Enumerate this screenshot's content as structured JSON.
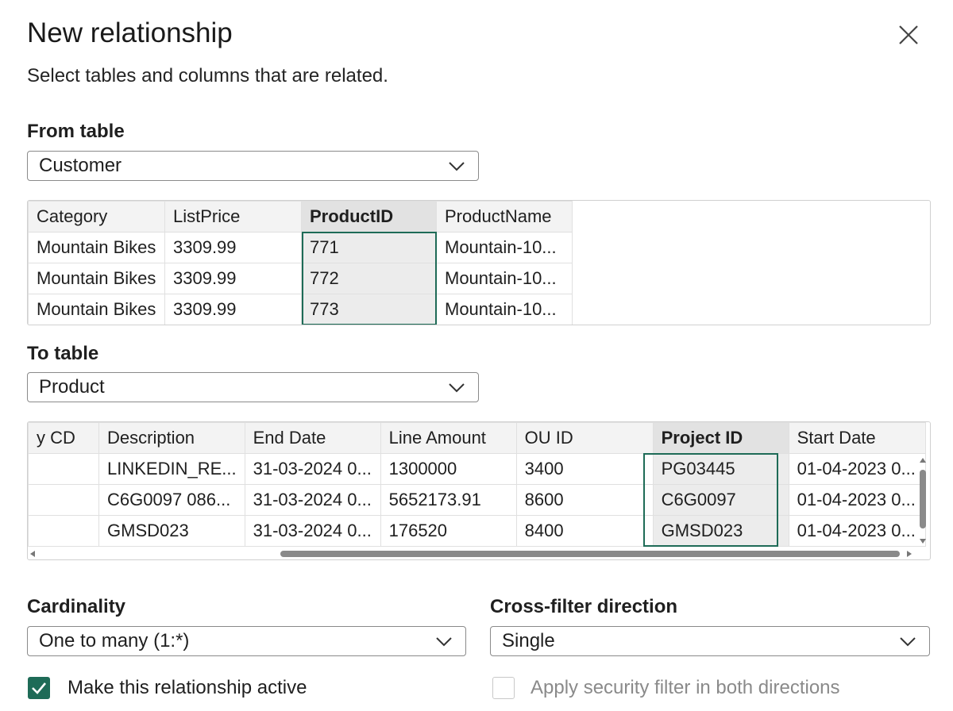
{
  "dialog": {
    "title": "New relationship",
    "subtitle": "Select tables and columns that are related."
  },
  "from_table": {
    "label": "From table",
    "selected": "Customer",
    "columns": [
      "Category",
      "ListPrice",
      "ProductID",
      "ProductName"
    ],
    "selected_column": "ProductID",
    "rows": [
      [
        "Mountain Bikes",
        "3309.99",
        "771",
        "Mountain-10..."
      ],
      [
        "Mountain Bikes",
        "3309.99",
        "772",
        "Mountain-10..."
      ],
      [
        "Mountain Bikes",
        "3309.99",
        "773",
        "Mountain-10..."
      ]
    ]
  },
  "to_table": {
    "label": "To table",
    "selected": "Product",
    "columns": [
      "y CD",
      "Description",
      "End Date",
      "Line Amount",
      "OU ID",
      "Project ID",
      "Start Date"
    ],
    "selected_column": "Project ID",
    "rows": [
      [
        "",
        "LINKEDIN_RE...",
        "31-03-2024 0...",
        "1300000",
        "3400",
        "PG03445",
        "01-04-2023 0..."
      ],
      [
        "",
        "C6G0097 086...",
        "31-03-2024 0...",
        "5652173.91",
        "8600",
        "C6G0097",
        "01-04-2023 0..."
      ],
      [
        "",
        "GMSD023",
        "31-03-2024 0...",
        "176520",
        "8400",
        "GMSD023",
        "01-04-2023 0..."
      ]
    ]
  },
  "cardinality": {
    "label": "Cardinality",
    "selected": "One to many (1:*)"
  },
  "cross_filter": {
    "label": "Cross-filter direction",
    "selected": "Single"
  },
  "options": {
    "active_label": "Make this relationship active",
    "active_checked": true,
    "security_label": "Apply security filter in both directions",
    "security_checked": false
  },
  "colors": {
    "accent": "#1e6b57",
    "selected_header": "#e2e2e2",
    "border": "#8a8a8a"
  },
  "icons": {
    "close": "close-icon",
    "dropdown": "chevron-down-icon",
    "check": "checkmark-icon"
  }
}
